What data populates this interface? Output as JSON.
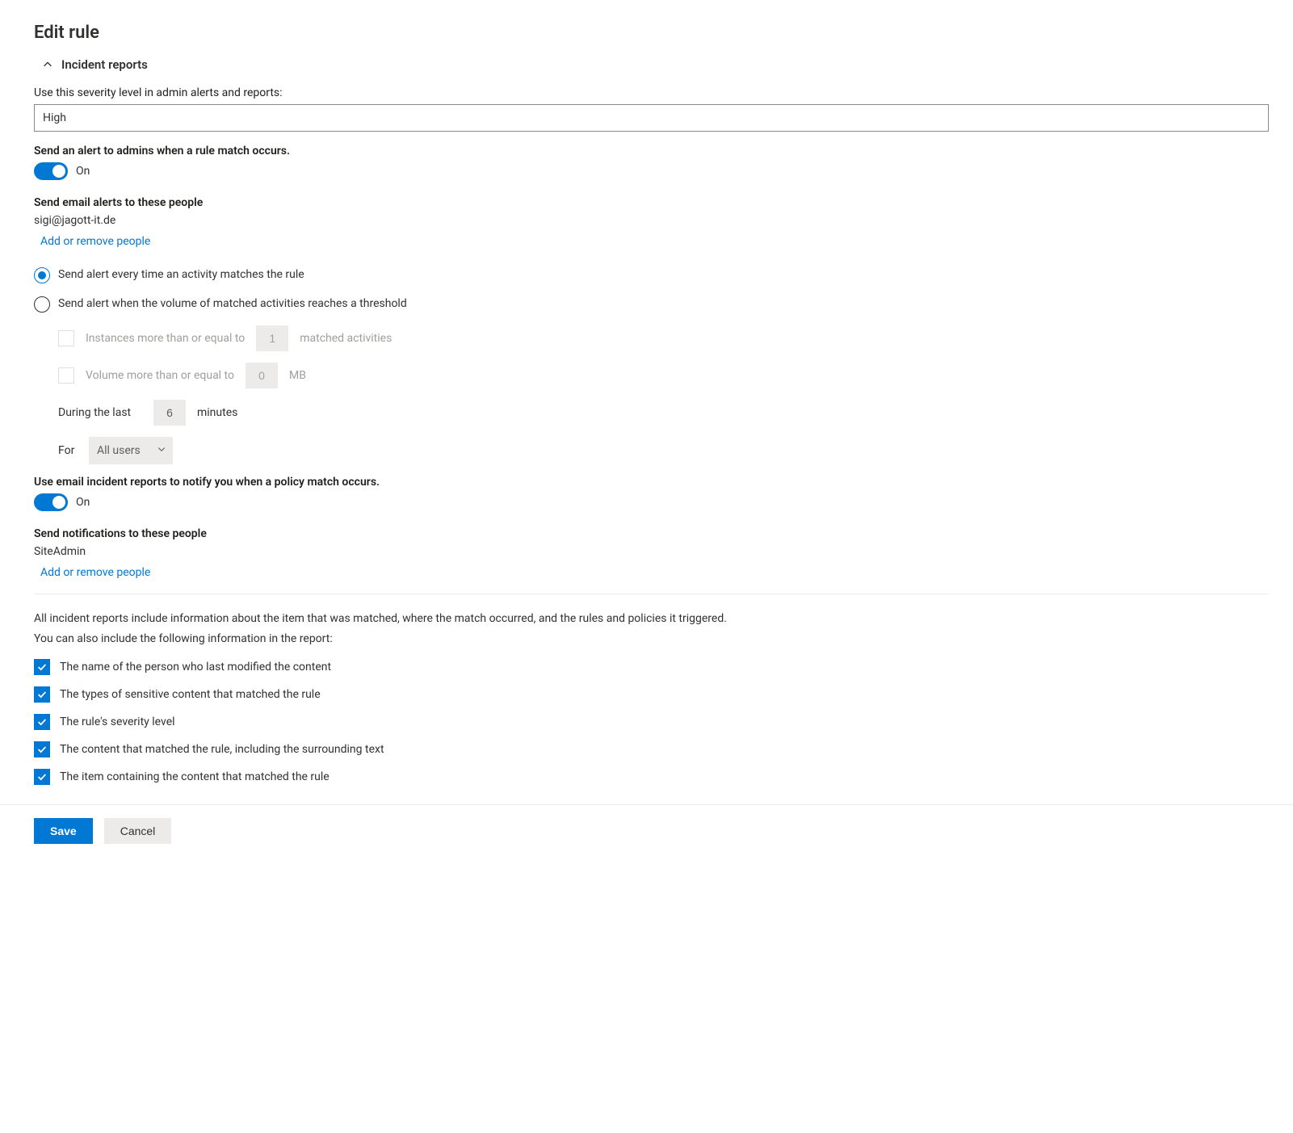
{
  "page_title": "Edit rule",
  "section": {
    "title": "Incident reports"
  },
  "severity": {
    "label": "Use this severity level in admin alerts and reports:",
    "value": "High"
  },
  "admin_alert": {
    "label": "Send an alert to admins when a rule match occurs.",
    "state": "On"
  },
  "email_alerts": {
    "label": "Send email alerts to these people",
    "value": "sigi@jagott-it.de",
    "link": "Add or remove people"
  },
  "alert_mode": {
    "every_time": "Send alert every time an activity matches the rule",
    "threshold": "Send alert when the volume of matched activities reaches a threshold"
  },
  "threshold": {
    "instances_label": "Instances more than or equal to",
    "instances_value": "1",
    "instances_suffix": "matched activities",
    "volume_label": "Volume more than or equal to",
    "volume_value": "0",
    "volume_suffix": "MB",
    "during_label": "During the last",
    "during_value": "6",
    "during_suffix": "minutes",
    "for_label": "For",
    "for_value": "All users"
  },
  "incident_email": {
    "label": "Use email incident reports to notify you when a policy match occurs.",
    "state": "On"
  },
  "notifications": {
    "label": "Send notifications to these people",
    "value": "SiteAdmin",
    "link": "Add or remove people"
  },
  "info": {
    "line1": "All incident reports include information about the item that was matched, where the match occurred, and the rules and policies it triggered.",
    "line2": "You can also include the following information in the report:"
  },
  "checks": {
    "c1": "The name of the person who last modified the content",
    "c2": "The types of sensitive content that matched the rule",
    "c3": "The rule's severity level",
    "c4": "The content that matched the rule, including the surrounding text",
    "c5": "The item containing the content that matched the rule"
  },
  "buttons": {
    "save": "Save",
    "cancel": "Cancel"
  }
}
